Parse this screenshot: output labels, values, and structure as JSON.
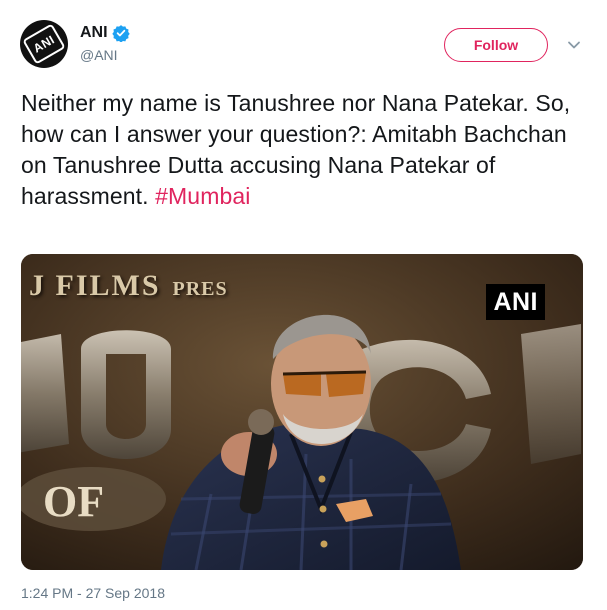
{
  "author": {
    "display_name": "ANI",
    "handle": "@ANI",
    "avatar_label": "ANI",
    "verified": true
  },
  "follow_button": {
    "label": "Follow"
  },
  "tweet": {
    "text": "Neither my name is Tanushree nor Nana Patekar. So, how can I answer your question?: Amitabh Bachchan on Tanushree Dutta accusing Nana Patekar of harassment.",
    "hashtag": "#Mumbai"
  },
  "media": {
    "banner_text": "J FILMS",
    "banner_text_small": "PRES",
    "watermark": "ANI"
  },
  "timestamp": "1:24 PM - 27 Sep 2018",
  "colors": {
    "accent": "#e0245e",
    "verified": "#1da1f2",
    "muted": "#657786",
    "text": "#14171a"
  },
  "icons": {
    "verified": "verified-badge-icon",
    "menu": "chevron-down-icon"
  }
}
